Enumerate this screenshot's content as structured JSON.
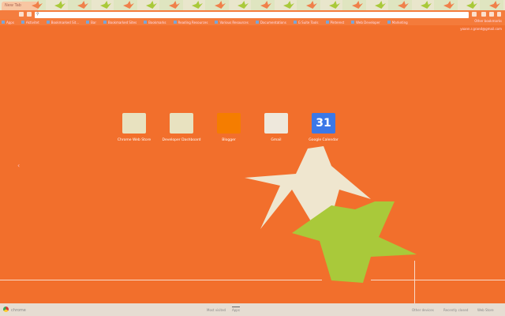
{
  "tab": {
    "title": "New Tab"
  },
  "omnibox": {
    "placeholder": ""
  },
  "bookmarks": [
    {
      "label": "Apps"
    },
    {
      "label": "Aktivitet"
    },
    {
      "label": "Bookmarked Sit..."
    },
    {
      "label": "Bar"
    },
    {
      "label": "Bookmarked Sites"
    },
    {
      "label": "Bookmarks"
    },
    {
      "label": "Reading Resources"
    },
    {
      "label": "Various Resources"
    },
    {
      "label": "Documentations"
    },
    {
      "label": "G Suite Tools"
    },
    {
      "label": "Pinterest"
    },
    {
      "label": "Web Developer"
    },
    {
      "label": "Marketing"
    }
  ],
  "other_bookmarks": "Other bookmarks",
  "account_email": "yoann.r.grand@gmail.com",
  "apps": [
    {
      "label": "Chrome Web Store",
      "icon": "chrome-web-store-icon",
      "color": "#e8e2c0"
    },
    {
      "label": "Developer Dashboard",
      "icon": "developer-dashboard-icon",
      "color": "#e8e2c0"
    },
    {
      "label": "Blogger",
      "icon": "blogger-icon",
      "color": "#f57d00"
    },
    {
      "label": "Gmail",
      "icon": "gmail-icon",
      "color": "#eee8dc"
    },
    {
      "label": "Google Calendar",
      "icon": "google-calendar-icon",
      "color": "#3b78e7",
      "text": "31"
    }
  ],
  "footer": {
    "brand": "chrome",
    "most_visited": "Most visited",
    "apps": "Apps",
    "recently_closed": "Recently closed",
    "web_store": "Web Store",
    "other": "Other devices"
  },
  "colors": {
    "background": "#f26f2c",
    "crane_cream": "#efe6cf",
    "crane_green": "#a9c93a"
  }
}
